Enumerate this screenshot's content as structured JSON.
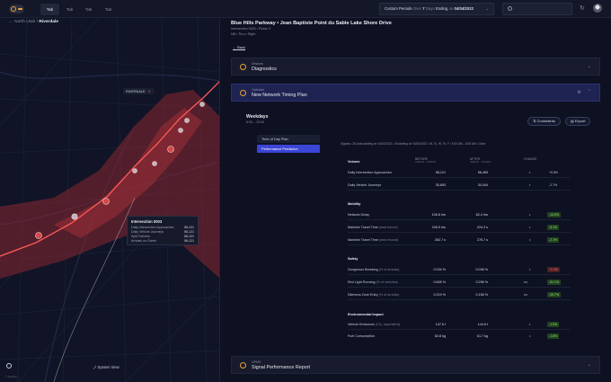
{
  "topbar": {
    "tabs": [
      "Tab",
      "Tab",
      "Tab",
      "Tab"
    ],
    "period": {
      "label": "Custom Periods",
      "over": "Over",
      "days": "7",
      "days_label": "Days",
      "ending": "Ending",
      "on": "on",
      "date": "04/04/2022"
    }
  },
  "map": {
    "breadcrumb": {
      "parent": "North Utah",
      "sep": "/",
      "current": "Riverdale"
    },
    "label": "RIVERDALE",
    "tooltip": {
      "title": "Intersection 0003",
      "rows": [
        {
          "k": "Daily Intersection Approaches",
          "v": "56,121"
        },
        {
          "k": "Daily Vehicle Journeys",
          "v": "56,121"
        },
        {
          "k": "Split Failures",
          "v": "56,121"
        },
        {
          "k": "Arrivals on Green",
          "v": "56,121"
        }
      ]
    },
    "system_view": "System View",
    "credit": "© Mapbox"
  },
  "detail": {
    "title": "Blue Hills Parkway • Jean Baptiste Point du Sable Lake Shore Drive",
    "sub1": "Intersection 0003 • Phase 3",
    "sub2": "NB • Thru • Right",
    "back": "Back",
    "sections": [
      {
        "cat": "Devices",
        "name": "Diagnostics"
      },
      {
        "cat": "Optimize",
        "name": "New Network Timing Plan"
      },
      {
        "cat": "UPMS",
        "name": "Signal Performance Report"
      }
    ],
    "weekdays": "Weekdays",
    "hours": "6:00 – 13:00",
    "constraints": "Constraints",
    "export": "Export",
    "side": [
      "Time of Day Plan",
      "Performance Prediction"
    ],
    "summary": "Signals • 28 Data starting on 04/03/2022 • 28 starting on 04/03/2022 • W, Tu, W, Th, F • 6:00 AM – 8:00 AM • Clear",
    "columns": {
      "before": "BEFORE",
      "before_range": "04/01/22 – 04/03/22",
      "after": "AFTER",
      "after_range": "04/04/22 – 04/10/22",
      "change": "CHANGE"
    },
    "groups": [
      {
        "title": "Volume",
        "rows": [
          {
            "label": "Daily Intersection Approaches",
            "unit": "",
            "before": "58,121",
            "after": "56,469",
            "dir": "•",
            "chg": "+0.6%",
            "tone": "n"
          },
          {
            "label": "Daily Vehicle Journeys",
            "unit": "",
            "before": "30,893",
            "after": "30,044",
            "dir": "•",
            "chg": "-2.7%",
            "tone": "n"
          }
        ]
      },
      {
        "title": "Mobility",
        "rows": [
          {
            "label": "Network Delay",
            "unit": "",
            "before": "106.8 hrs",
            "after": "82.4 hrs",
            "dir": "•",
            "chg": "-13.5%",
            "tone": "g"
          },
          {
            "label": "Mainline Travel Time",
            "unit": "(east bound)",
            "before": "246.5 hrs",
            "after": "224.3 s",
            "dir": "•",
            "chg": "-9.1%",
            "tone": "g"
          },
          {
            "label": "Mainline Travel Time",
            "unit": "(west bound)",
            "before": "282.7 s",
            "after": "276.7 s",
            "dir": "•",
            "chg": "-2.1%",
            "tone": "g"
          }
        ]
      },
      {
        "title": "Safety",
        "rows": [
          {
            "label": "Dangerous Breaking",
            "unit": "(% of arrivals)",
            "before": "0.034 %",
            "after": "0.038 %",
            "dir": "•",
            "chg": "+1.3%",
            "tone": "r"
          },
          {
            "label": "Red Light Running",
            "unit": "(% of vehicles)",
            "before": "0.605 %",
            "after": "0.296 %",
            "dir": "•••",
            "chg": "-51.1%",
            "tone": "g"
          },
          {
            "label": "Dilemma Zone Entry",
            "unit": "(% of arrivals)",
            "before": "0.219 %",
            "after": "0.158 %",
            "dir": "•••",
            "chg": "-25.7%",
            "tone": "g"
          }
        ]
      },
      {
        "title": "Environmental Impact",
        "rows": [
          {
            "label": "Vehicle Emissions",
            "unit": "(CO₂ equivalent)",
            "before": "147.6 t",
            "after": "144.8 t",
            "dir": "•",
            "chg": "-1.9%",
            "tone": "g"
          },
          {
            "label": "Fuel Consumption",
            "unit": "",
            "before": "62.8 kg",
            "after": "61.7 kg",
            "dir": "•",
            "chg": "-1.8%",
            "tone": "g"
          }
        ]
      }
    ]
  },
  "colors": {
    "accent": "#3b45d6",
    "brand": "#e8a33a",
    "good": "#9be07e",
    "bad": "#ff7676"
  }
}
